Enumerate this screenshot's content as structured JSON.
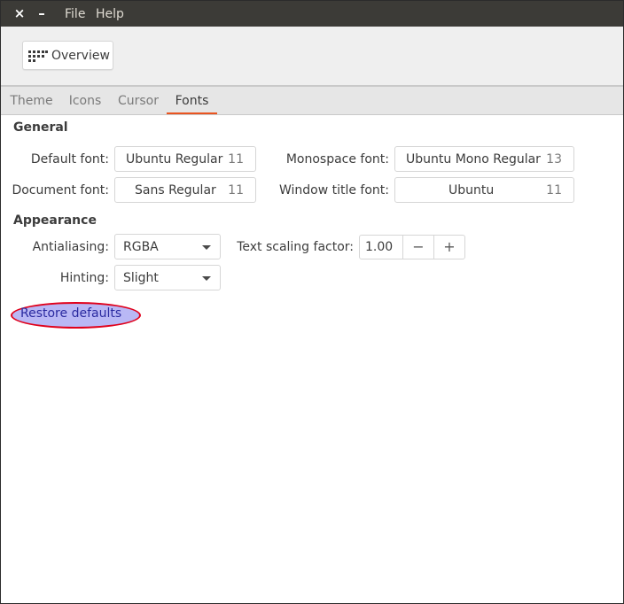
{
  "titlebar": {
    "close_glyph": "×",
    "minimize_glyph": "–",
    "menus": [
      "File",
      "Help"
    ]
  },
  "toolbar": {
    "overview_label": "Overview",
    "overview_icon": "grid-icon"
  },
  "tabs": [
    {
      "label": "Theme",
      "active": false
    },
    {
      "label": "Icons",
      "active": false
    },
    {
      "label": "Cursor",
      "active": false
    },
    {
      "label": "Fonts",
      "active": true
    }
  ],
  "general": {
    "title": "General",
    "default_font": {
      "label": "Default font:",
      "name": "Ubuntu Regular",
      "size": "11"
    },
    "monospace_font": {
      "label": "Monospace font:",
      "name": "Ubuntu Mono Regular",
      "size": "13"
    },
    "document_font": {
      "label": "Document font:",
      "name": "Sans Regular",
      "size": "11"
    },
    "window_title_font": {
      "label": "Window title font:",
      "name": "Ubuntu",
      "size": "11"
    }
  },
  "appearance": {
    "title": "Appearance",
    "antialiasing": {
      "label": "Antialiasing:",
      "value": "RGBA"
    },
    "hinting": {
      "label": "Hinting:",
      "value": "Slight"
    },
    "text_scaling": {
      "label": "Text scaling factor:",
      "value": "1.00",
      "minus": "−",
      "plus": "+"
    }
  },
  "restore_label": "Restore defaults",
  "colors": {
    "titlebar": "#3c3b37",
    "accent": "#e95420",
    "highlight_fill": "#b9b8f5",
    "highlight_outline": "#e0001b"
  }
}
